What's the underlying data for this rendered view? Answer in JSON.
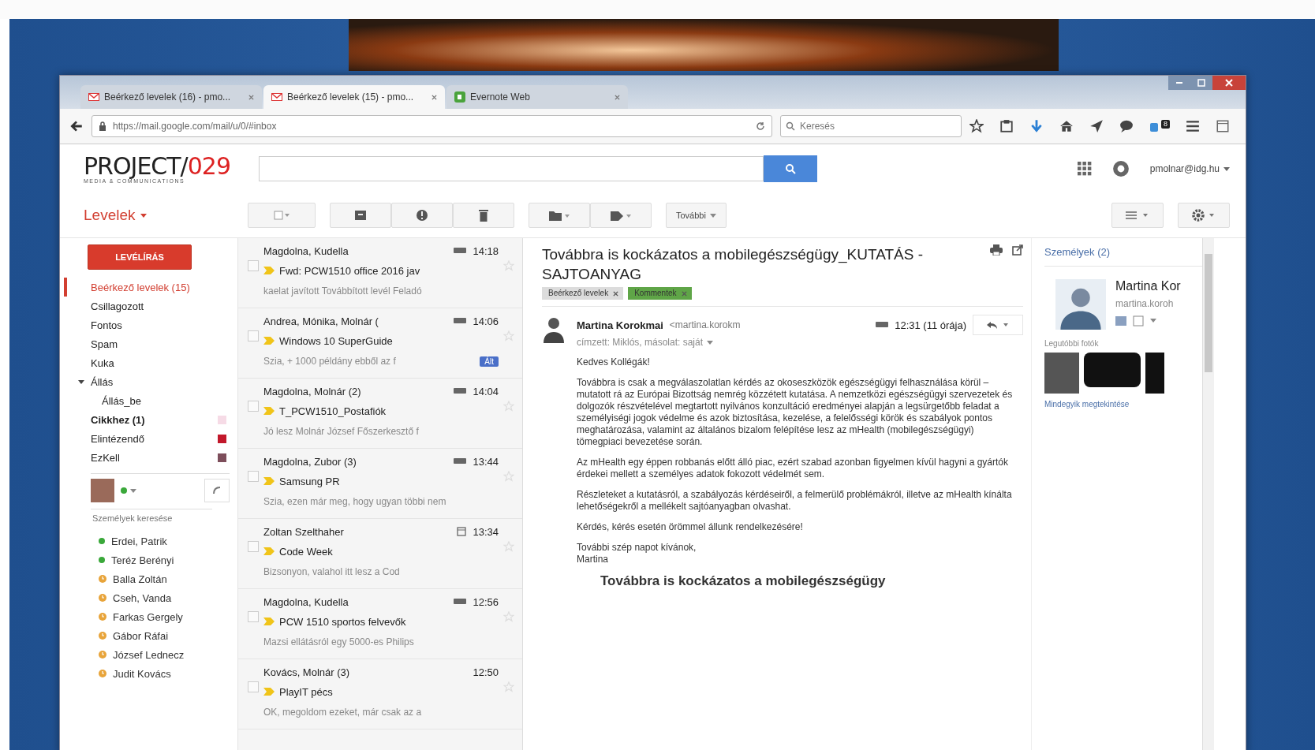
{
  "browser": {
    "tabs": [
      {
        "title": "Beérkező levelek (16) - pmo...",
        "kind": "gmail",
        "selected": false
      },
      {
        "title": "Beérkező levelek (15) - pmo...",
        "kind": "gmail",
        "selected": true
      },
      {
        "title": "Evernote Web",
        "kind": "evernote",
        "selected": false
      }
    ],
    "address": "https://mail.google.com/mail/u/0/#inbox",
    "search_placeholder": "Keresés",
    "badge": "8"
  },
  "app": {
    "logo_main": "PROJECT/",
    "logo_accent": "029",
    "logo_sub": "MEDIA & COMMUNICATIONS",
    "account": "pmolnar@idg.hu",
    "mail_menu": "Levelek",
    "compose": "LEVÉLÍRÁS",
    "more": "További"
  },
  "folders": [
    {
      "label": "Beérkező levelek (15)",
      "selected": true,
      "bold": false
    },
    {
      "label": "Csillagozott",
      "selected": false,
      "bold": false
    },
    {
      "label": "Fontos",
      "selected": false,
      "bold": false
    },
    {
      "label": "Spam",
      "selected": false,
      "bold": false
    },
    {
      "label": "Kuka",
      "selected": false,
      "bold": false
    },
    {
      "label": "Állás",
      "selected": false,
      "bold": false,
      "expanded": true,
      "children": [
        {
          "label": "Állás_be",
          "selected": false,
          "bold": false
        }
      ]
    },
    {
      "label": "Cikkhez (1)",
      "selected": false,
      "bold": true,
      "color": "#f6dbe6"
    },
    {
      "label": "Elintézendő",
      "selected": false,
      "bold": false,
      "color": "#c2182b"
    },
    {
      "label": "EzKell",
      "selected": false,
      "bold": false,
      "color": "#7d4e5b"
    }
  ],
  "chat": {
    "search_placeholder": "Személyek keresése",
    "contacts": [
      {
        "name": "Erdei, Patrik",
        "kind": "online"
      },
      {
        "name": "Teréz Berényi",
        "kind": "online"
      },
      {
        "name": "Balla Zoltán",
        "kind": "away"
      },
      {
        "name": "Cseh, Vanda",
        "kind": "away"
      },
      {
        "name": "Farkas Gergely",
        "kind": "away"
      },
      {
        "name": "Gábor Ráfai",
        "kind": "away"
      },
      {
        "name": "József Lednecz",
        "kind": "away"
      },
      {
        "name": "Judit Kovács",
        "kind": "away"
      }
    ]
  },
  "messages": [
    {
      "from": "Magdolna, Kudella",
      "time": "14:18",
      "kind": "chat",
      "checked": false,
      "subject": "Fwd: PCW1510 office 2016 jav",
      "snippet": "kaelat javított Továbbított levél Feladó"
    },
    {
      "from": "Andrea, Mónika, Molnár (",
      "time": "14:06",
      "kind": "chat",
      "checked": false,
      "subject": "Windows 10 SuperGuide",
      "snippet": "Szia, + 1000 példány ebből az f",
      "tag": "Ált"
    },
    {
      "from": "Magdolna, Molnár (2)",
      "time": "14:04",
      "kind": "chat",
      "checked": false,
      "subject": "T_PCW1510_Postafiók",
      "snippet": "Jó lesz Molnár József Főszerkesztő f"
    },
    {
      "from": "Magdolna, Zubor (3)",
      "time": "13:44",
      "kind": "chat",
      "checked": false,
      "subject": "Samsung PR",
      "snippet": "Szia, ezen már meg, hogy ugyan többi nem"
    },
    {
      "from": "Zoltan Szelthaher",
      "time": "13:34",
      "kind": "calendar",
      "checked": false,
      "subject": "Code Week",
      "snippet": "Bizsonyon, valahol itt lesz a Cod"
    },
    {
      "from": "Magdolna, Kudella",
      "time": "12:56",
      "kind": "chat",
      "checked": false,
      "subject": "PCW 1510 sportos felvevők",
      "snippet": "Mazsi ellátásról egy 5000-es Philips"
    },
    {
      "from": "Kovács, Molnár (3)",
      "time": "12:50",
      "kind": "plain",
      "checked": false,
      "subject": "PlayIT pécs",
      "snippet": "OK, megoldom ezeket, már csak az a"
    }
  ],
  "email": {
    "subject": "Továbbra is kockázatos a mobilegészségügy_KUTATÁS - SAJTOANYAG",
    "labels": [
      {
        "text": "Beérkező levelek",
        "color": "#dcdcdc"
      },
      {
        "text": "Kommentek",
        "color": "#5fa547"
      }
    ],
    "sender": "Martina Korokmai",
    "address": "<martina.korokm",
    "time": "12:31 (11 órája)",
    "recipients": "címzett: Miklós, másolat: saját",
    "body": [
      "Kedves Kollégák!",
      "Továbbra is csak a megválaszolatlan kérdés az okoseszközök egészségügyi felhasználása körül – mutatott rá az Európai Bizottság nemrég közzétett kutatása. A nemzetközi egészségügyi szervezetek és dolgozók részvételével megtartott nyilvános konzultáció eredményei alapján a legsürgetőbb feladat a személyiségi jogok védelme és azok biztosítása, kezelése, a felelősségi körök és szabályok pontos meghatározása, valamint az általános bizalom felépítése lesz az mHealth (mobilegészségügyi) tömegpiaci bevezetése során.",
      "Az mHealth egy éppen robbanás előtt álló piac, ezért szabad azonban figyelmen kívül hagyni a gyártók érdekei mellett a személyes adatok fokozott védelmét sem.",
      "Részleteket a kutatásról, a szabályozás kérdéseiről, a felmerülő problémákról, illetve az mHealth kínálta lehetőségekről a mellékelt sajtóanyagban olvashat.",
      "Kérdés, kérés esetén örömmel állunk rendelkezésére!"
    ],
    "closing": [
      "További szép napot kívánok,",
      "Martina"
    ],
    "heading": "Továbbra is kockázatos a mobilegészségügy"
  },
  "people": {
    "title": "Személyek (2)",
    "name": "Martina Kor",
    "email": "martina.koroh",
    "photos_label": "Legutóbbi fotók",
    "more_link": "Mindegyik megtekintése"
  }
}
